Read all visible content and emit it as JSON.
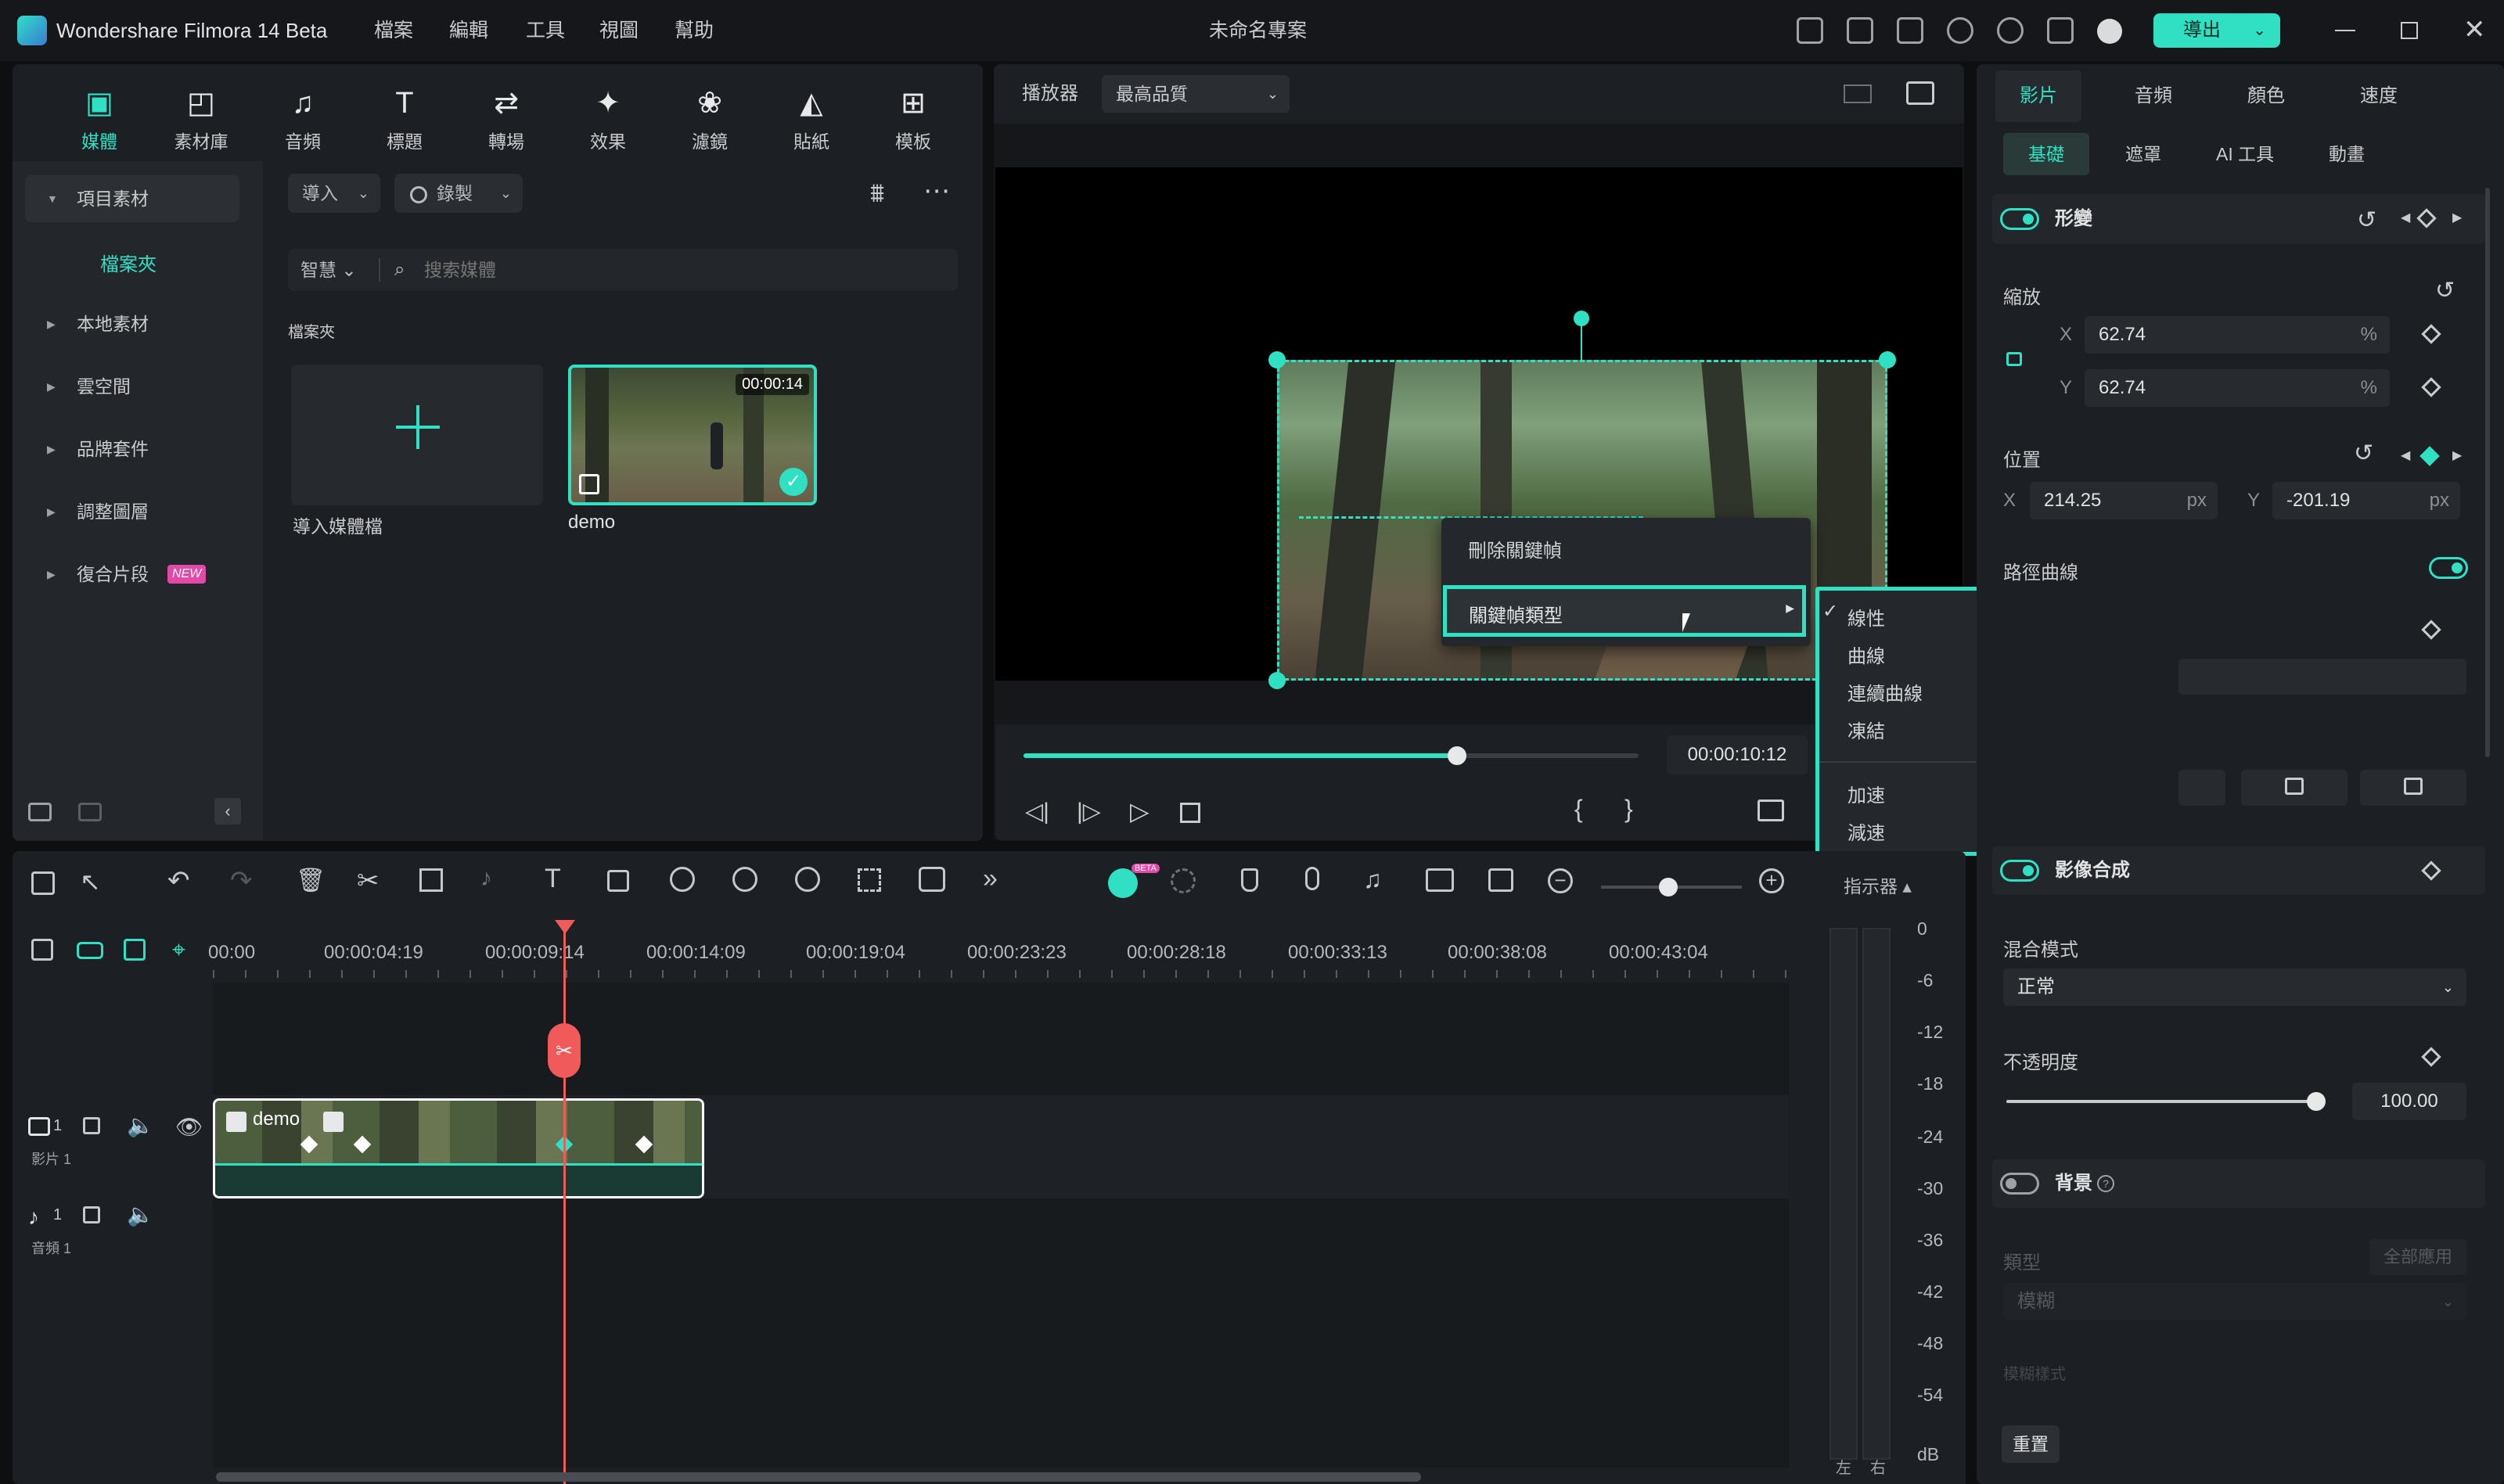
{
  "app": {
    "title": "Wondershare Filmora 14 Beta",
    "project": "未命名專案",
    "export_label": "導出"
  },
  "menu": [
    "檔案",
    "編輯",
    "工具",
    "視圖",
    "幫助"
  ],
  "toolbar_tabs": [
    {
      "label": "媒體",
      "icon": "media-icon"
    },
    {
      "label": "素材庫",
      "icon": "stock-icon"
    },
    {
      "label": "音頻",
      "icon": "music-note-icon"
    },
    {
      "label": "標題",
      "icon": "title-t-icon"
    },
    {
      "label": "轉場",
      "icon": "transition-icon"
    },
    {
      "label": "效果",
      "icon": "effects-icon"
    },
    {
      "label": "濾鏡",
      "icon": "filters-icon"
    },
    {
      "label": "貼紙",
      "icon": "sticker-icon"
    },
    {
      "label": "模板",
      "icon": "template-icon"
    }
  ],
  "sidebar": {
    "project_media": "項目素材",
    "folder": "檔案夾",
    "items": [
      "本地素材",
      "雲空間",
      "品牌套件",
      "調整圖層",
      "復合片段"
    ],
    "new_badge": "NEW"
  },
  "media": {
    "import_label": "導入",
    "record_label": "錄製",
    "smart_label": "智慧",
    "search_placeholder": "搜索媒體",
    "folder_label": "檔案夾",
    "import_tile_label": "導入媒體檔",
    "clip_name": "demo",
    "clip_duration": "00:00:14"
  },
  "player": {
    "label": "播放器",
    "quality": "最高品質",
    "timecode": "00:00:10:12",
    "progress": 0.705
  },
  "context_menu": {
    "delete_keyframe": "刪除關鍵幀",
    "keyframe_type": "關鍵幀類型"
  },
  "submenu": {
    "items": [
      "線性",
      "曲線",
      "連續曲線",
      "凍結"
    ],
    "items2": [
      "加速",
      "減速"
    ],
    "checked": "線性"
  },
  "timeline": {
    "ruler": [
      "00:00",
      "00:00:04:19",
      "00:00:09:14",
      "00:00:14:09",
      "00:00:19:04",
      "00:00:23:23",
      "00:00:28:18",
      "00:00:33:13",
      "00:00:38:08",
      "00:00:43:04"
    ],
    "clip_name": "demo",
    "video_track_label": "影片 1",
    "audio_track_label": "音頻 1",
    "track_number": "1",
    "indicator_label": "指示器",
    "meter_scale": [
      "0",
      "-6",
      "-12",
      "-18",
      "-24",
      "-30",
      "-36",
      "-42",
      "-48",
      "-54",
      "dB"
    ],
    "meter_lr": [
      "左",
      "右"
    ],
    "beta_badge": "BETA"
  },
  "properties": {
    "main_tabs": [
      "影片",
      "音頻",
      "顏色",
      "速度"
    ],
    "sub_tabs": [
      "基礎",
      "遮罩",
      "AI 工具",
      "動畫"
    ],
    "transform": "形變",
    "scale": "縮放",
    "scale_x": "62.74",
    "scale_y": "62.74",
    "percent": "%",
    "position": "位置",
    "pos_x": "214.25",
    "pos_y": "-201.19",
    "px": "px",
    "x_label": "X",
    "y_label": "Y",
    "path_curve": "路徑曲線",
    "compositing": "影像合成",
    "blend_mode": "混合模式",
    "blend_value": "正常",
    "opacity": "不透明度",
    "opacity_value": "100.00",
    "opacity_fraction": 1.0,
    "background": "背景",
    "type": "類型",
    "apply_all": "全部應用",
    "blur": "模糊",
    "blur_style": "模糊樣式",
    "reset": "重置"
  },
  "colors": {
    "accent": "#2fe0c3",
    "playhead": "#f05a5a",
    "panel": "#1c1f23"
  }
}
